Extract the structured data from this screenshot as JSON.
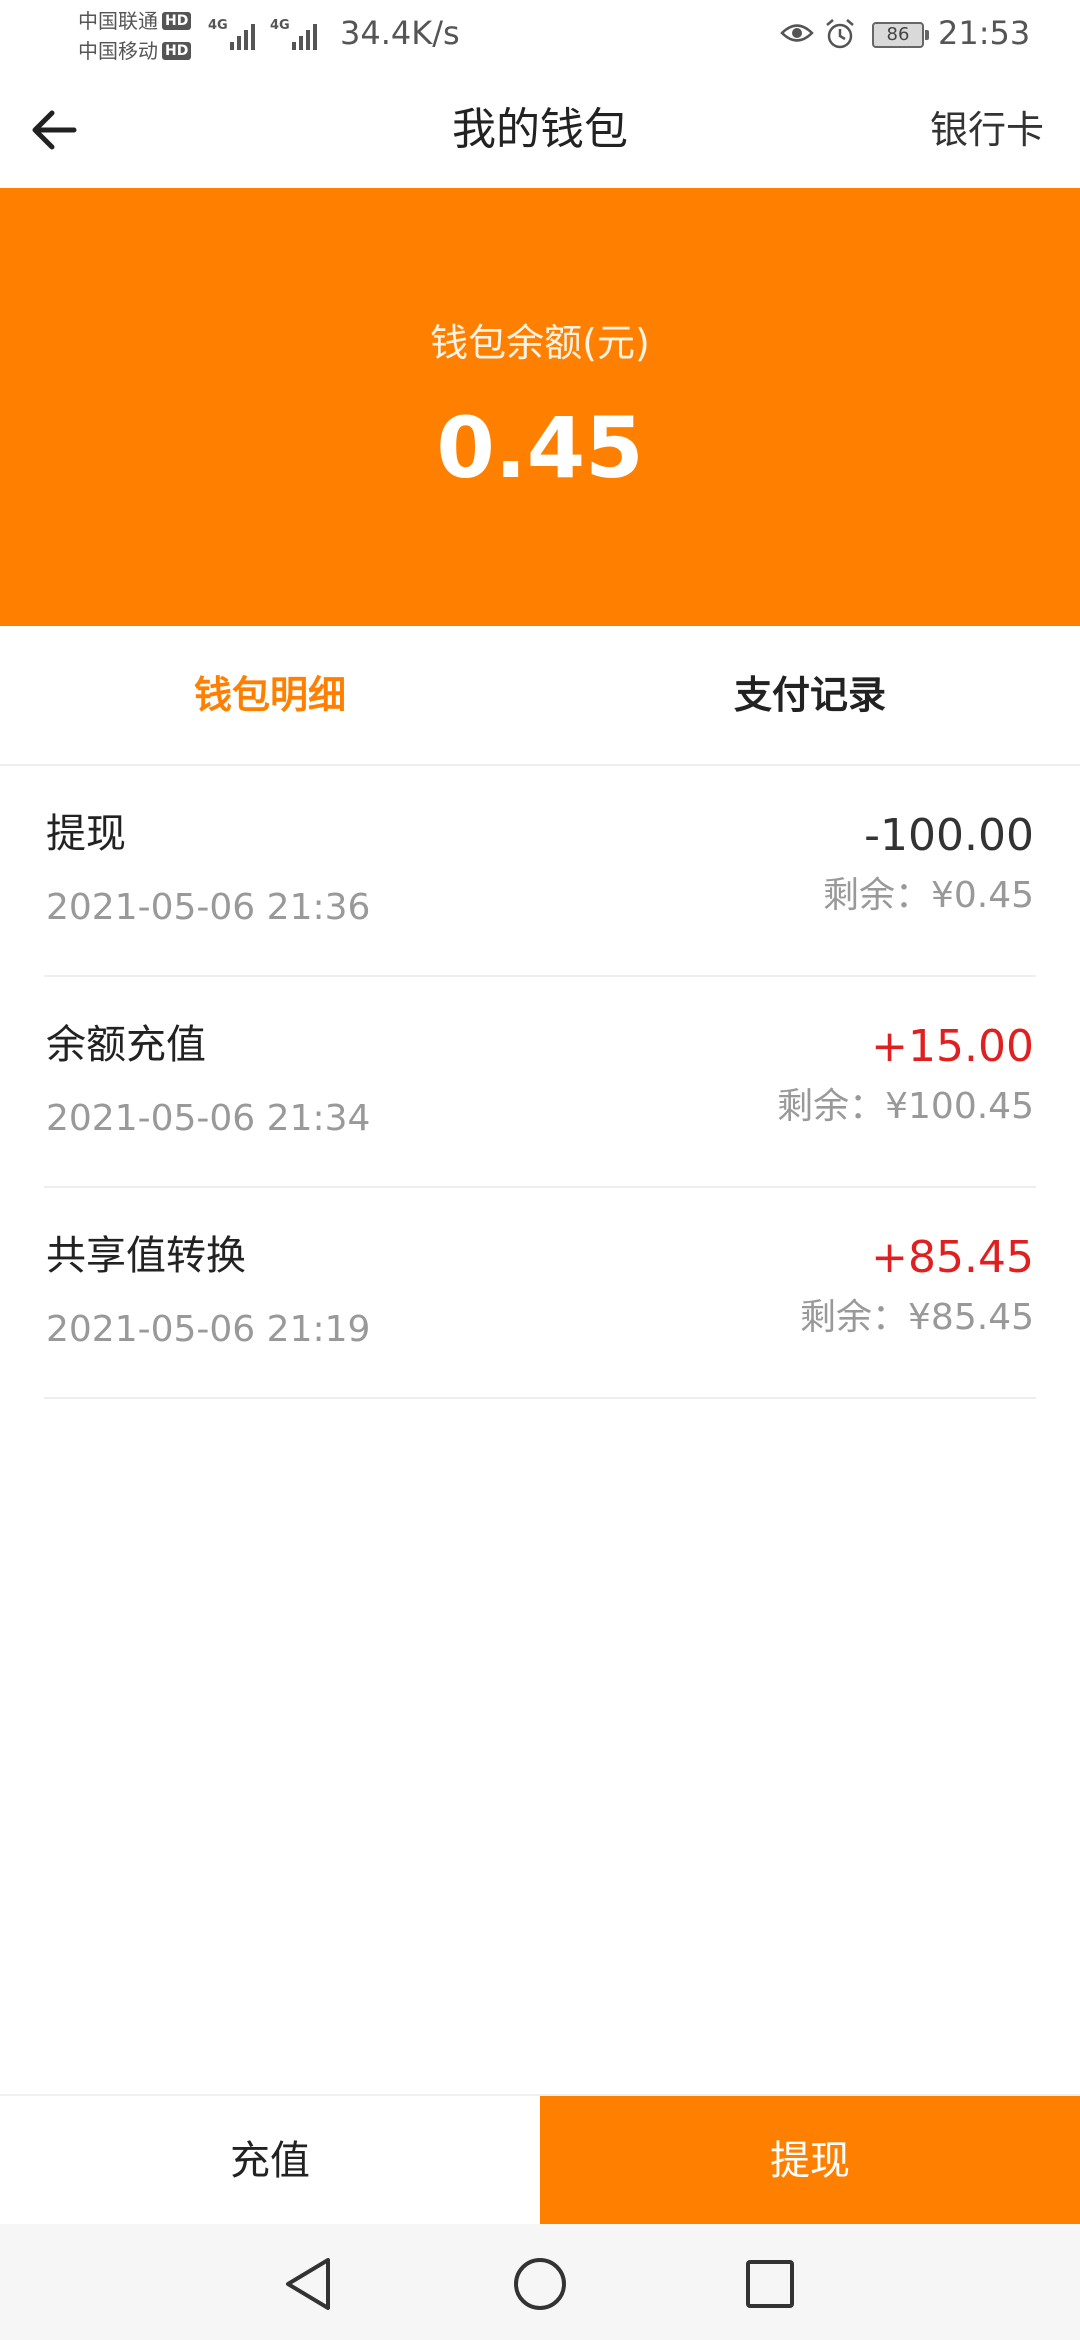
{
  "status_bar": {
    "carrier1": "中国联通",
    "carrier2": "中国移动",
    "hd_label": "HD",
    "network1": "4G",
    "network2": "4G",
    "speed": "34.4K/s",
    "battery": "86",
    "time": "21:53"
  },
  "nav": {
    "title": "我的钱包",
    "right_link": "银行卡",
    "back_icon": "arrow-left-icon"
  },
  "balance": {
    "label": "钱包余额(元)",
    "value": "0.45"
  },
  "tabs": [
    {
      "label": "钱包明细",
      "active": true
    },
    {
      "label": "支付记录",
      "active": false
    }
  ],
  "records": [
    {
      "title": "提现",
      "time": "2021-05-06 21:36",
      "amount": "-100.00",
      "remain": "剩余：¥0.45",
      "sign": "negative"
    },
    {
      "title": "余额充值",
      "time": "2021-05-06 21:34",
      "amount": "+15.00",
      "remain": "剩余：¥100.45",
      "sign": "positive"
    },
    {
      "title": "共享值转换",
      "time": "2021-05-06 21:19",
      "amount": "+85.45",
      "remain": "剩余：¥85.45",
      "sign": "positive"
    }
  ],
  "actions": {
    "recharge": "充值",
    "withdraw": "提现"
  },
  "colors": {
    "accent": "#ff8000",
    "positive": "#e02020",
    "muted": "#999999"
  }
}
